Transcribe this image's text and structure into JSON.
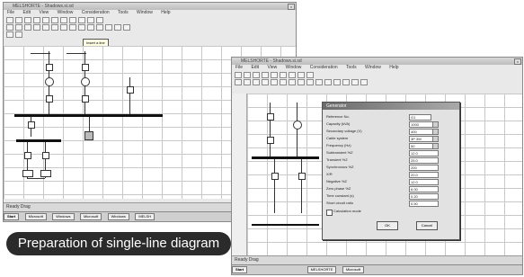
{
  "caption": "Preparation of single-line diagram",
  "window_back": {
    "title": "MELSHORTE - Shadows.si.sd",
    "menu": [
      "File",
      "Edit",
      "View",
      "Window",
      "Consideration",
      "Tools",
      "Window",
      "Help"
    ],
    "tooltip": "Insert a line",
    "status": "Ready Drag",
    "taskbar": [
      "Start",
      "Microsoft",
      "Windows",
      "Microsoft",
      "Windows",
      "MELSH"
    ]
  },
  "window_front": {
    "title": "MELSHORTE - Shadows.si.sd",
    "menu": [
      "File",
      "Edit",
      "View",
      "Window",
      "Consideration",
      "Tools",
      "Window",
      "Help"
    ],
    "status": "Ready Drag",
    "taskbar": [
      "Start",
      "MELSHORTE",
      "Microsoft"
    ]
  },
  "dialog": {
    "title": "Generator",
    "fields": [
      {
        "label": "Reference No.",
        "value": "G1"
      },
      {
        "label": "Capacity (kVA)",
        "value": "1000"
      },
      {
        "label": "Secondary voltage (V)",
        "value": "400"
      },
      {
        "label": "Cable system",
        "value": "3P 3W"
      },
      {
        "label": "Frequency (Hz)",
        "value": "50"
      },
      {
        "label": "Subtransient %Z",
        "value": "12.0"
      },
      {
        "label": "Transient %Z",
        "value": "25.0"
      },
      {
        "label": "Synchronous %Z",
        "value": "200"
      },
      {
        "label": "X/R",
        "value": "20.0"
      },
      {
        "label": "Negative %Z",
        "value": "12.0"
      },
      {
        "label": "Zero phase %Z",
        "value": "6.00"
      },
      {
        "label": "Time constant (s)",
        "value": "0.20"
      },
      {
        "label": "Short circuit ratio",
        "value": "0.50"
      }
    ],
    "checkbox": "Calculation mode",
    "ok": "OK",
    "cancel": "Cancel"
  },
  "colors": {
    "caption_bg": "#2b2b2b",
    "grid": "#c8c8c8",
    "dialog_title": "#6b6b6b"
  }
}
